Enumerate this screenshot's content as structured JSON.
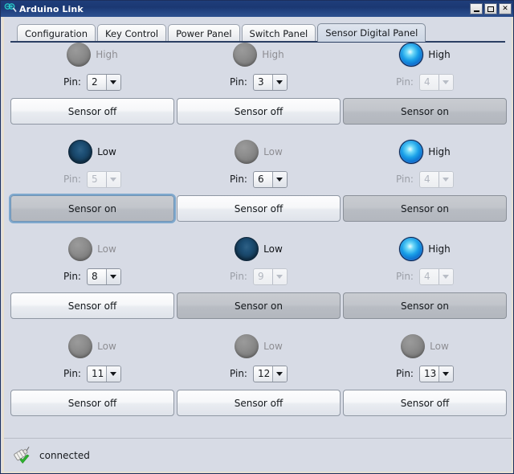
{
  "window": {
    "title": "Arduino Link",
    "icon": "arduino-link-icon",
    "buttons": {
      "minimize": "_",
      "maximize": "□",
      "close": "✕"
    }
  },
  "tabs": [
    {
      "label": "Configuration",
      "selected": false
    },
    {
      "label": "Key Control",
      "selected": false
    },
    {
      "label": "Power Panel",
      "selected": false
    },
    {
      "label": "Switch Panel",
      "selected": false
    },
    {
      "label": "Sensor Digital Panel",
      "selected": true
    }
  ],
  "pin_label": "Pin:",
  "sensors": [
    {
      "led_state": "gray",
      "led_label": "High",
      "led_label_muted": true,
      "pin_value": "2",
      "pin_enabled": true,
      "button_label": "Sensor off",
      "button_state": "off",
      "button_focused": false
    },
    {
      "led_state": "gray",
      "led_label": "High",
      "led_label_muted": true,
      "pin_value": "3",
      "pin_enabled": true,
      "button_label": "Sensor off",
      "button_state": "off",
      "button_focused": false
    },
    {
      "led_state": "bright",
      "led_label": "High",
      "led_label_muted": false,
      "pin_value": "4",
      "pin_enabled": false,
      "button_label": "Sensor on",
      "button_state": "on",
      "button_focused": false
    },
    {
      "led_state": "dim",
      "led_label": "Low",
      "led_label_muted": false,
      "pin_value": "5",
      "pin_enabled": false,
      "button_label": "Sensor on",
      "button_state": "on",
      "button_focused": true
    },
    {
      "led_state": "gray",
      "led_label": "Low",
      "led_label_muted": true,
      "pin_value": "6",
      "pin_enabled": true,
      "button_label": "Sensor off",
      "button_state": "off",
      "button_focused": false
    },
    {
      "led_state": "bright",
      "led_label": "High",
      "led_label_muted": false,
      "pin_value": "4",
      "pin_enabled": false,
      "button_label": "Sensor on",
      "button_state": "on",
      "button_focused": false
    },
    {
      "led_state": "gray",
      "led_label": "Low",
      "led_label_muted": true,
      "pin_value": "8",
      "pin_enabled": true,
      "button_label": "Sensor off",
      "button_state": "off",
      "button_focused": false
    },
    {
      "led_state": "dim",
      "led_label": "Low",
      "led_label_muted": false,
      "pin_value": "9",
      "pin_enabled": false,
      "button_label": "Sensor on",
      "button_state": "on",
      "button_focused": false
    },
    {
      "led_state": "bright",
      "led_label": "High",
      "led_label_muted": false,
      "pin_value": "4",
      "pin_enabled": false,
      "button_label": "Sensor on",
      "button_state": "on",
      "button_focused": false
    },
    {
      "led_state": "gray",
      "led_label": "Low",
      "led_label_muted": true,
      "pin_value": "11",
      "pin_enabled": true,
      "button_label": "Sensor off",
      "button_state": "off",
      "button_focused": false
    },
    {
      "led_state": "gray",
      "led_label": "Low",
      "led_label_muted": true,
      "pin_value": "12",
      "pin_enabled": true,
      "button_label": "Sensor off",
      "button_state": "off",
      "button_focused": false
    },
    {
      "led_state": "gray",
      "led_label": "Low",
      "led_label_muted": true,
      "pin_value": "13",
      "pin_enabled": true,
      "button_label": "Sensor off",
      "button_state": "off",
      "button_focused": false
    }
  ],
  "statusbar": {
    "icon": "connected-plug-check-icon",
    "text": "connected"
  },
  "colors": {
    "titlebar": "#1f3e7b",
    "panel_bg": "#d7dbe5",
    "window_frame": "#e7e0d2",
    "led_on": "#1aa0e8",
    "led_off": "#163f5e",
    "led_disabled": "#8d8d8d",
    "tab_underline": "#2b3f63",
    "focus_ring": "#7ea8cd",
    "check_green": "#2fb32f"
  }
}
